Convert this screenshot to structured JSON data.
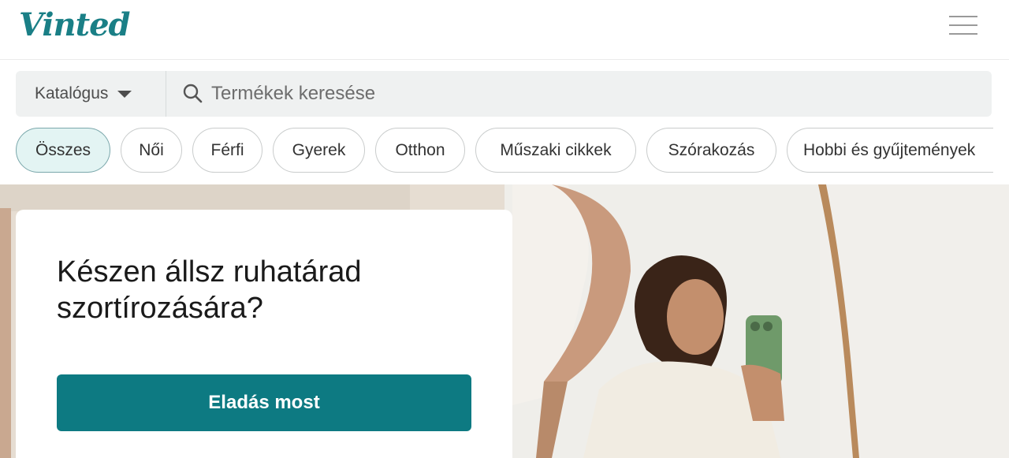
{
  "header": {
    "logo": "Vinted",
    "menu_icon": "hamburger-menu-icon"
  },
  "search": {
    "catalog_label": "Katalógus",
    "placeholder": "Termékek keresése",
    "icon": "search-icon"
  },
  "categories": [
    {
      "label": "Összes",
      "active": true
    },
    {
      "label": "Női",
      "active": false
    },
    {
      "label": "Férfi",
      "active": false
    },
    {
      "label": "Gyerek",
      "active": false
    },
    {
      "label": "Otthon",
      "active": false
    },
    {
      "label": "Műszaki cikkek",
      "active": false
    },
    {
      "label": "Szórakozás",
      "active": false
    },
    {
      "label": "Hobbi és gyűjtemények",
      "active": false
    }
  ],
  "hero": {
    "title": "Készen állsz ruhatárad szortírozására?",
    "cta": "Eladás most"
  },
  "colors": {
    "brand": "#1a7f86",
    "cta": "#0d7a82",
    "active_chip_bg": "#e3f4f3"
  }
}
